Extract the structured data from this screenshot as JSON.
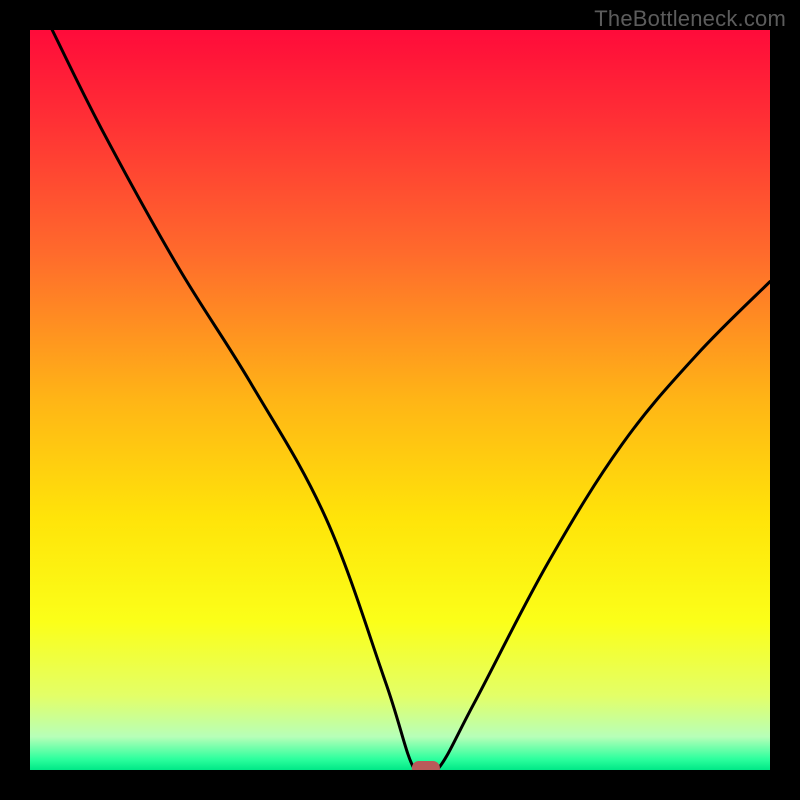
{
  "watermark": "TheBottleneck.com",
  "chart_data": {
    "type": "line",
    "title": "",
    "xlabel": "",
    "ylabel": "",
    "xlim": [
      0,
      100
    ],
    "ylim": [
      0,
      100
    ],
    "series": [
      {
        "name": "bottleneck-curve",
        "x": [
          3,
          10,
          20,
          30,
          40,
          48,
          52,
          55,
          60,
          70,
          80,
          90,
          100
        ],
        "y": [
          100,
          86,
          68,
          52,
          34,
          12,
          0,
          0,
          9,
          28,
          44,
          56,
          66
        ]
      }
    ],
    "annotations": [
      {
        "name": "minimum-marker",
        "x": 53.5,
        "y": 0
      }
    ],
    "background_gradient": {
      "stops": [
        {
          "pos": 0.0,
          "color": "#ff0b3a"
        },
        {
          "pos": 0.12,
          "color": "#ff2f35"
        },
        {
          "pos": 0.3,
          "color": "#ff6a2c"
        },
        {
          "pos": 0.5,
          "color": "#ffb516"
        },
        {
          "pos": 0.66,
          "color": "#ffe409"
        },
        {
          "pos": 0.8,
          "color": "#fbff19"
        },
        {
          "pos": 0.9,
          "color": "#e3ff68"
        },
        {
          "pos": 0.955,
          "color": "#b7ffb8"
        },
        {
          "pos": 0.985,
          "color": "#2eff9e"
        },
        {
          "pos": 1.0,
          "color": "#00e887"
        }
      ]
    },
    "marker_color": "#b95a5a"
  }
}
